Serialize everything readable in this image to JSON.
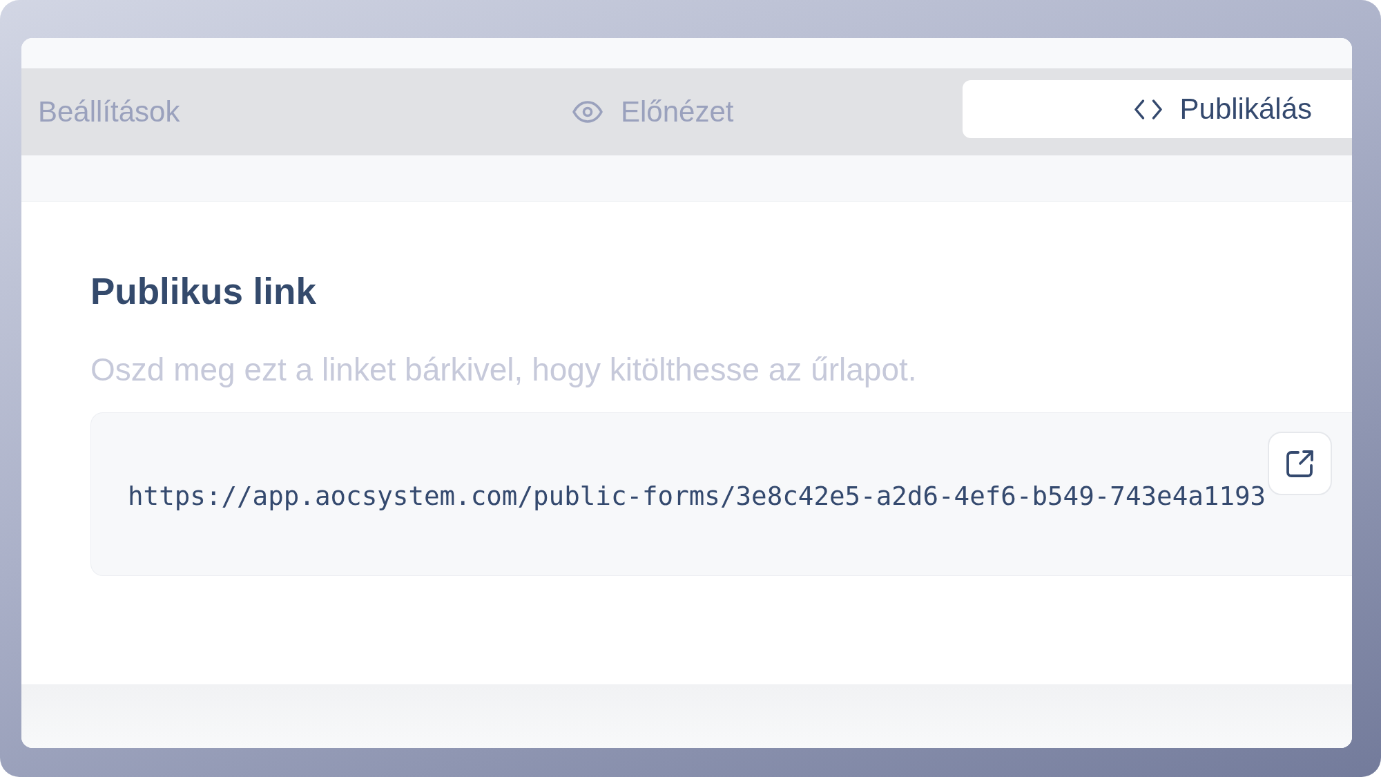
{
  "tabs": [
    {
      "label": "Beállítások",
      "kind": "plain",
      "selected": false
    },
    {
      "label": "Előnézet",
      "kind": "preview",
      "selected": false
    },
    {
      "label": "Publikálás",
      "kind": "code",
      "selected": true
    }
  ],
  "section": {
    "title": "Publikus link",
    "description": "Oszd meg ezt a linket bárkivel, hogy kitölthesse az űrlapot.",
    "link": {
      "url": "https://app.aocsystem.com/public-forms/3e8c42e5-a2d6-4ef6-b549-743e4a1193"
    }
  }
}
